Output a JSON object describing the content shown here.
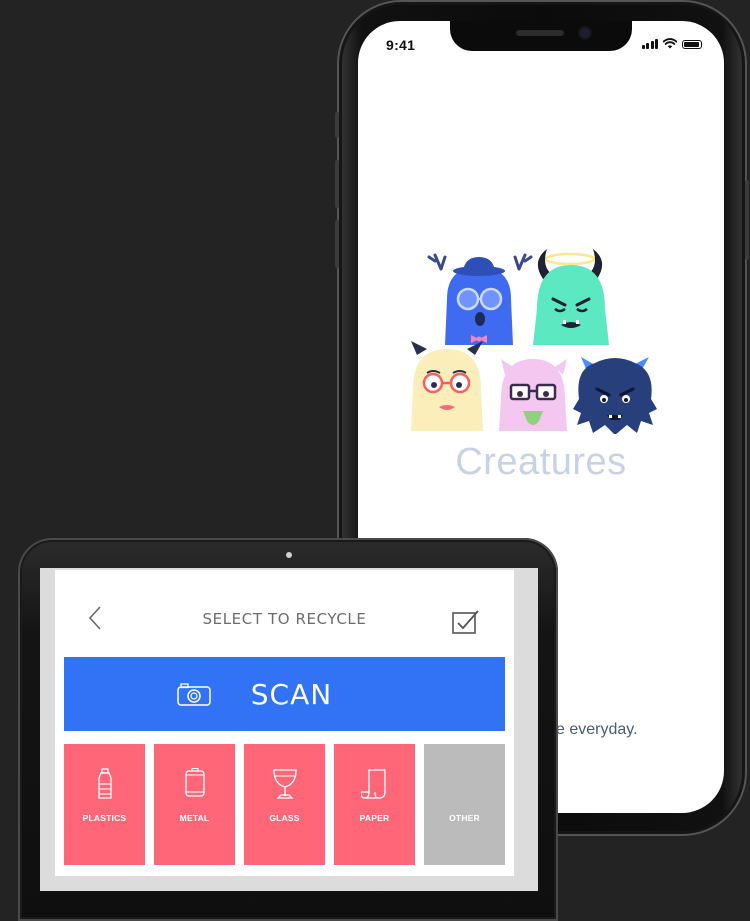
{
  "phone": {
    "status_time": "9:41",
    "app_name": "Creatures",
    "tagline_partial": "e everyday."
  },
  "tablet": {
    "header_title": "SELECT TO RECYCLE",
    "scan_label": "SCAN",
    "categories": [
      {
        "label": "PLASTICS",
        "icon": "bottle-icon",
        "color": "#ff6779"
      },
      {
        "label": "METAL",
        "icon": "can-icon",
        "color": "#ff6779"
      },
      {
        "label": "GLASS",
        "icon": "wine-glass-icon",
        "color": "#ff6779"
      },
      {
        "label": "PAPER",
        "icon": "paper-scroll-icon",
        "color": "#ff6779"
      },
      {
        "label": "OTHER",
        "icon": "",
        "color": "#bbbbbb"
      }
    ]
  },
  "colors": {
    "background": "#232323",
    "scan_blue": "#3273f6",
    "category_pink": "#ff6779",
    "other_gray": "#bbbbbb",
    "app_name_text": "#c9d1e4"
  }
}
